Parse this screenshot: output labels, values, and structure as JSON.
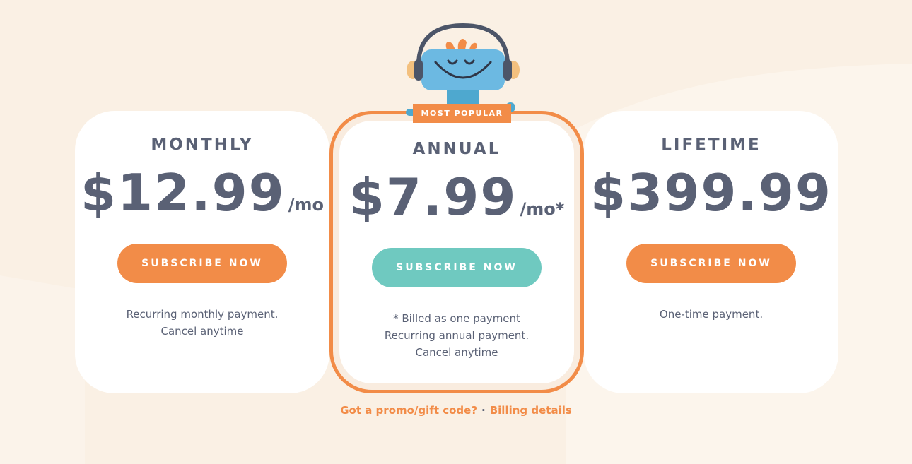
{
  "badge": {
    "label": "MOST POPULAR"
  },
  "plans": {
    "monthly": {
      "name": "MONTHLY",
      "price": "$12.99",
      "unit": "/mo",
      "button": "SUBSCRIBE NOW",
      "desc_line1": "Recurring monthly payment.",
      "desc_line2": "Cancel anytime"
    },
    "annual": {
      "name": "ANNUAL",
      "price": "$7.99",
      "unit": "/mo*",
      "button": "SUBSCRIBE NOW",
      "desc_line1": "* Billed as one payment",
      "desc_line2": "Recurring annual payment. Cancel anytime"
    },
    "lifetime": {
      "name": "LIFETIME",
      "price": "$399.99",
      "button": "SUBSCRIBE NOW",
      "desc_line1": "One-time payment."
    }
  },
  "footer": {
    "promo_link": "Got a promo/gift code?",
    "separator": "·",
    "billing_link": "Billing details"
  },
  "colors": {
    "accent_orange": "#f28c48",
    "accent_teal": "#6fc9c0",
    "text": "#5a6175",
    "background": "#faf0e4"
  }
}
